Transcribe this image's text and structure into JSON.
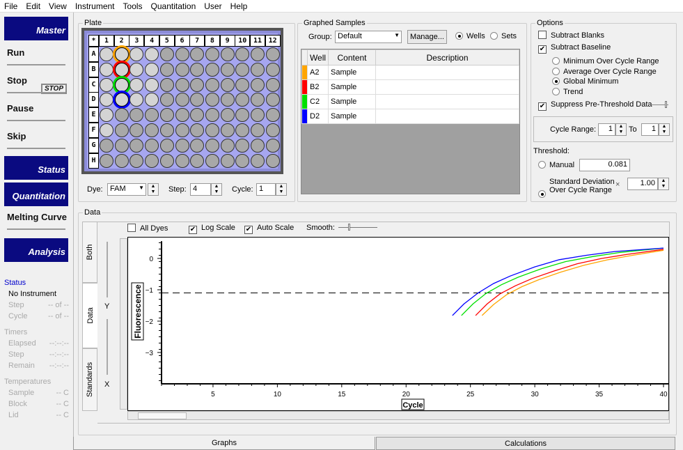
{
  "menu": [
    "File",
    "Edit",
    "View",
    "Instrument",
    "Tools",
    "Quantitation",
    "User",
    "Help"
  ],
  "toolbar": [
    {
      "label": "Master",
      "style": "dark"
    },
    {
      "label": "Run",
      "style": "light"
    },
    {
      "label": "Stop",
      "style": "light",
      "badge": "STOP"
    },
    {
      "label": "Pause",
      "style": "light"
    },
    {
      "label": "Skip",
      "style": "light"
    },
    {
      "label": "Status",
      "style": "dark"
    },
    {
      "label": "Quantitation",
      "style": "dark"
    },
    {
      "label": "Melting Curve",
      "style": "light"
    },
    {
      "label": "Analysis",
      "style": "dark"
    }
  ],
  "status": {
    "title": "Status",
    "instrument": "No Instrument",
    "rows": [
      {
        "label": "Step",
        "value": "-- of --"
      },
      {
        "label": "Cycle",
        "value": "-- of --"
      }
    ],
    "timers_title": "Timers",
    "timers": [
      {
        "label": "Elapsed",
        "value": "--:--:--"
      },
      {
        "label": "Step",
        "value": "--:--:--"
      },
      {
        "label": "Remain",
        "value": "--:--:--"
      }
    ],
    "temps_title": "Temperatures",
    "temps": [
      {
        "label": "Sample",
        "value": "-- C"
      },
      {
        "label": "Block",
        "value": "-- C"
      },
      {
        "label": "Lid",
        "value": "-- C"
      }
    ]
  },
  "plate": {
    "title": "Plate",
    "corner": "*",
    "columns": [
      "1",
      "2",
      "3",
      "4",
      "5",
      "6",
      "7",
      "8",
      "9",
      "10",
      "11",
      "12"
    ],
    "rows": [
      "A",
      "B",
      "C",
      "D",
      "E",
      "F",
      "G",
      "H"
    ],
    "light_wells": [
      "A1",
      "A2",
      "A3",
      "A4",
      "B1",
      "B2",
      "B3",
      "B4",
      "C1",
      "C2",
      "C3",
      "C4",
      "D1",
      "D2",
      "D3",
      "D4",
      "E1",
      "F1"
    ],
    "selected": [
      {
        "well": "A2",
        "color": "#ffa500"
      },
      {
        "well": "B2",
        "color": "#ff0000"
      },
      {
        "well": "C2",
        "color": "#00e000"
      },
      {
        "well": "D2",
        "color": "#0000ff"
      }
    ],
    "dye_label": "Dye:",
    "dye": "FAM",
    "step_label": "Step:",
    "step": "4",
    "cycle_label": "Cycle:",
    "cycle": "1"
  },
  "graphed": {
    "title": "Graphed Samples",
    "group_label": "Group:",
    "group": "Default",
    "manage": "Manage...",
    "wells": "Wells",
    "sets": "Sets",
    "headers": [
      "Well",
      "Content",
      "Description"
    ],
    "rows": [
      {
        "well": "A2",
        "content": "Sample",
        "description": "",
        "color": "#ffa500"
      },
      {
        "well": "B2",
        "content": "Sample",
        "description": "",
        "color": "#ff0000"
      },
      {
        "well": "C2",
        "content": "Sample",
        "description": "",
        "color": "#00e000"
      },
      {
        "well": "D2",
        "content": "Sample",
        "description": "",
        "color": "#0000ff"
      }
    ]
  },
  "options": {
    "title": "Options",
    "subtract_blanks": "Subtract Blanks",
    "subtract_baseline": "Subtract Baseline",
    "baseline_methods": [
      "Minimum Over Cycle Range",
      "Average Over Cycle Range",
      "Global Minimum",
      "Trend"
    ],
    "baseline_selected": "Global Minimum",
    "suppress": "Suppress Pre-Threshold Data",
    "cycle_range_label": "Cycle Range:",
    "from": "1",
    "to_label": "To",
    "to": "1",
    "threshold_label": "Threshold:",
    "manual": "Manual",
    "manual_value": "0.081",
    "stddev_line1": "Standard Deviation",
    "stddev_line2": "Over Cycle Range",
    "times": "×",
    "stddev_value": "1.00"
  },
  "data": {
    "title": "Data",
    "tabs": [
      "Both",
      "Data",
      "Standards"
    ],
    "all_dyes": "All Dyes",
    "log_scale": "Log Scale",
    "auto_scale": "Auto Scale",
    "smooth": "Smooth:",
    "y_slider": "Y",
    "x_slider": "X"
  },
  "bottom_tabs": [
    "Graphs",
    "Calculations"
  ],
  "chart_data": {
    "type": "line",
    "xlabel": "Cycle",
    "ylabel": "Fluorescence",
    "xlim": [
      1,
      40
    ],
    "ylim": [
      -4,
      0.55
    ],
    "xticks": [
      5,
      10,
      15,
      20,
      25,
      30,
      35,
      40
    ],
    "yticks": [
      0,
      -1,
      -2,
      -3
    ],
    "threshold": -1.1,
    "grid": false,
    "series": [
      {
        "well": "A2",
        "color": "#ffa500",
        "x": [
          25.9,
          26.8,
          27.8,
          29,
          30.3,
          32,
          33.8,
          35.7,
          37.6,
          40
        ],
        "y": [
          -1.82,
          -1.47,
          -1.16,
          -0.9,
          -0.68,
          -0.44,
          -0.22,
          -0.04,
          0.1,
          0.26
        ]
      },
      {
        "well": "B2",
        "color": "#ff0000",
        "x": [
          25.4,
          26.3,
          27.3,
          28.5,
          29.8,
          31.5,
          33.3,
          35.2,
          37.2,
          40
        ],
        "y": [
          -1.82,
          -1.45,
          -1.13,
          -0.87,
          -0.64,
          -0.4,
          -0.17,
          0.0,
          0.13,
          0.29
        ]
      },
      {
        "well": "C2",
        "color": "#00e000",
        "x": [
          24.3,
          25.2,
          26.2,
          27.4,
          28.7,
          30.5,
          32.4,
          34.5,
          36.6,
          40
        ],
        "y": [
          -1.82,
          -1.45,
          -1.12,
          -0.84,
          -0.6,
          -0.33,
          -0.1,
          0.06,
          0.19,
          0.33
        ]
      },
      {
        "well": "D2",
        "color": "#0000ff",
        "x": [
          23.6,
          24.5,
          25.6,
          26.8,
          28.1,
          30,
          31.9,
          34,
          36.2,
          40
        ],
        "y": [
          -1.82,
          -1.45,
          -1.1,
          -0.8,
          -0.56,
          -0.27,
          -0.04,
          0.1,
          0.22,
          0.33
        ]
      }
    ]
  }
}
